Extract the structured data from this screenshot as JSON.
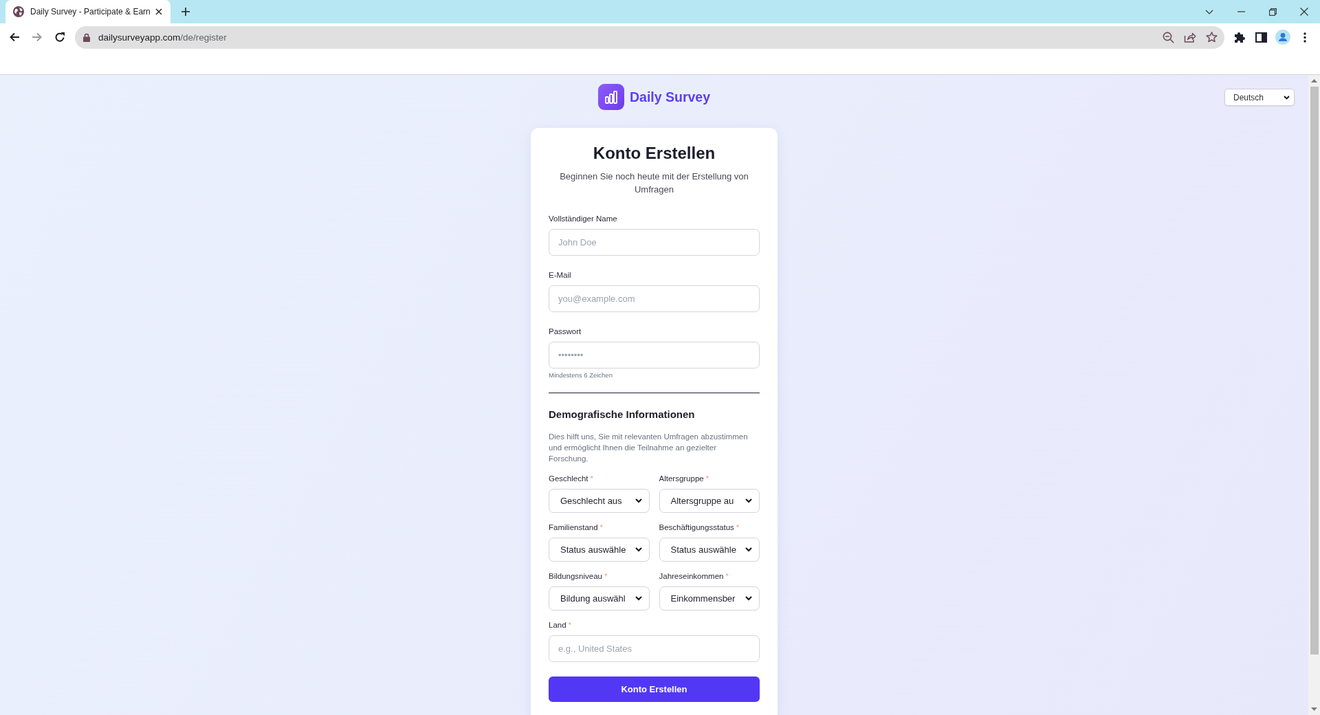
{
  "browser": {
    "tabs": [
      {
        "title": "Daily Survey - Participate & Earn",
        "selected": true
      }
    ],
    "forward_disabled": true,
    "url": {
      "host": "dailysurveyapp.com",
      "path": "/de/register"
    }
  },
  "language_select": {
    "value": "Deutsch"
  },
  "brand": {
    "name": "Daily Survey"
  },
  "card": {
    "title": "Konto Erstellen",
    "subtitle": "Beginnen Sie noch heute mit der Erstellung von Umfragen",
    "account_fields": [
      {
        "label": "Vollständiger Name",
        "placeholder": "John Doe"
      },
      {
        "label": "E-Mail",
        "placeholder": "you@example.com"
      },
      {
        "label": "Passwort",
        "placeholder": "••••••••",
        "hint": "Mindestens 6 Zeichen"
      }
    ],
    "demographics": {
      "title": "Demografische Informationen",
      "description": "Dies hilft uns, Sie mit relevanten Umfragen abzustimmen und ermöglicht Ihnen die Teilnahme an gezielter Forschung.",
      "fields": [
        {
          "kind": "select",
          "label": "Geschlecht",
          "required_mark": "*",
          "value": "Geschlecht aus"
        },
        {
          "kind": "select",
          "label": "Altersgruppe",
          "required_mark": "*",
          "value": "Altersgruppe au"
        },
        {
          "kind": "select",
          "label": "Familienstand",
          "required_mark": "*",
          "value": "Status auswähle"
        },
        {
          "kind": "select",
          "label": "Beschäftigungsstatus",
          "required_mark": "*",
          "value": "Status auswähle"
        },
        {
          "kind": "select",
          "label": "Bildungsniveau",
          "required_mark": "*",
          "value": "Bildung auswähl"
        },
        {
          "kind": "select",
          "label": "Jahreseinkommen",
          "required_mark": "*",
          "value": "Einkommensber"
        },
        {
          "kind": "input",
          "label": "Land",
          "required_mark": "*",
          "placeholder": "e.g., United States"
        }
      ]
    },
    "submit": "Konto Erstellen"
  }
}
